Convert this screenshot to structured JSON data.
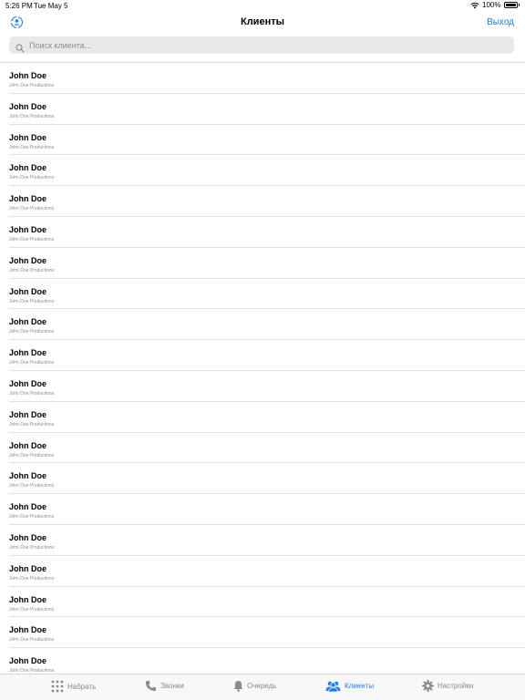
{
  "status_bar": {
    "time": "5:26 PM",
    "date": "Tue May 5",
    "battery": "100%"
  },
  "nav": {
    "title": "Клиенты",
    "logout_label": "Выход",
    "left_icon": "sync-user-icon"
  },
  "search": {
    "placeholder": "Поиск клиента...",
    "value": ""
  },
  "clients": [
    {
      "name": "John Doe",
      "company": "John Doe Productions"
    },
    {
      "name": "John Doe",
      "company": "John Doe Productions"
    },
    {
      "name": "John Doe",
      "company": "John Doe Productions"
    },
    {
      "name": "John Doe",
      "company": "John Doe Productions"
    },
    {
      "name": "John Doe",
      "company": "John Doe Productions"
    },
    {
      "name": "John Doe",
      "company": "John Doe Productions"
    },
    {
      "name": "John Doe",
      "company": "John Doe Productions"
    },
    {
      "name": "John Doe",
      "company": "John Doe Productions"
    },
    {
      "name": "John Doe",
      "company": "John Doe Productions"
    },
    {
      "name": "John Doe",
      "company": "John Doe Productions"
    },
    {
      "name": "John Doe",
      "company": "John Doe Productions"
    },
    {
      "name": "John Doe",
      "company": "John Doe Productions"
    },
    {
      "name": "John Doe",
      "company": "John Doe Productions"
    },
    {
      "name": "John Doe",
      "company": "John Doe Productions"
    },
    {
      "name": "John Doe",
      "company": "John Doe Productions"
    },
    {
      "name": "John Doe",
      "company": "John Doe Productions"
    },
    {
      "name": "John Doe",
      "company": "John Doe Productions"
    },
    {
      "name": "John Doe",
      "company": "John Doe Productions"
    },
    {
      "name": "John Doe",
      "company": "John Doe Productions"
    },
    {
      "name": "John Doe",
      "company": "John Doe Productions"
    }
  ],
  "tabs": [
    {
      "label": "Набрать",
      "icon": "keypad-icon",
      "active": false
    },
    {
      "label": "Звонки",
      "icon": "phone-icon",
      "active": false
    },
    {
      "label": "Очередь",
      "icon": "bell-icon",
      "active": false
    },
    {
      "label": "Клиенты",
      "icon": "people-icon",
      "active": true
    },
    {
      "label": "Настройки",
      "icon": "gear-icon",
      "active": false
    }
  ],
  "colors": {
    "accent": "#1a7ef2",
    "inactive": "#8a8a8e"
  }
}
